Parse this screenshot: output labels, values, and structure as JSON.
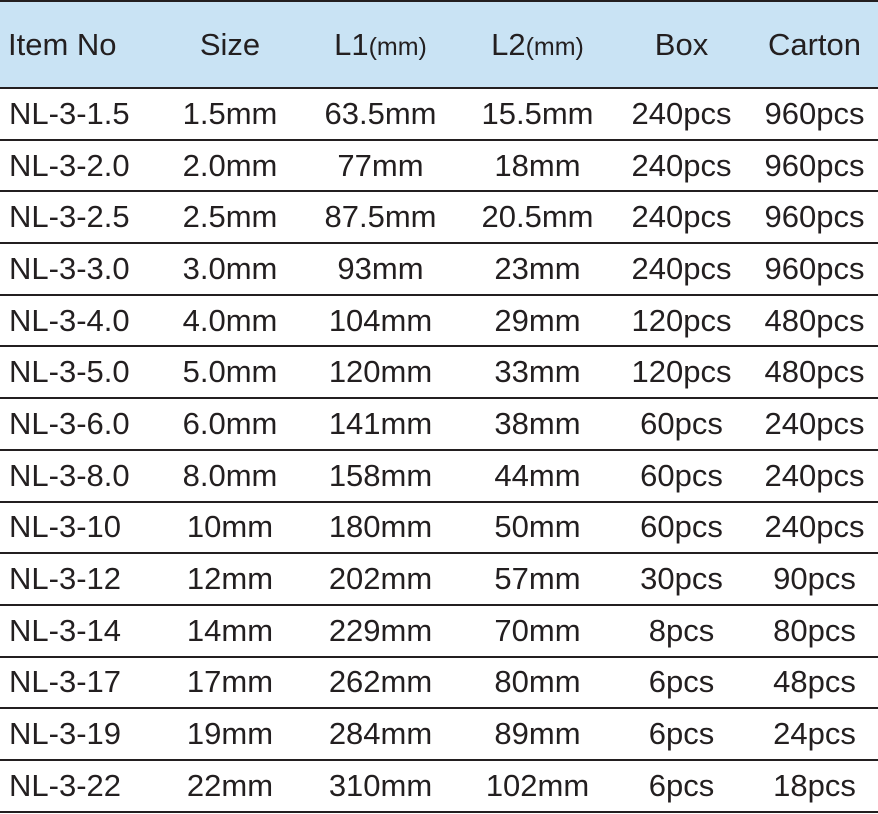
{
  "table": {
    "headers": [
      {
        "label": "Item No",
        "unit": ""
      },
      {
        "label": "Size",
        "unit": ""
      },
      {
        "label": "L1",
        "unit": "(mm)"
      },
      {
        "label": "L2",
        "unit": "(mm)"
      },
      {
        "label": "Box",
        "unit": ""
      },
      {
        "label": "Carton",
        "unit": ""
      }
    ],
    "rows": [
      [
        "NL-3-1.5",
        "1.5mm",
        "63.5mm",
        "15.5mm",
        "240pcs",
        "960pcs"
      ],
      [
        "NL-3-2.0",
        "2.0mm",
        "77mm",
        "18mm",
        "240pcs",
        "960pcs"
      ],
      [
        "NL-3-2.5",
        "2.5mm",
        "87.5mm",
        "20.5mm",
        "240pcs",
        "960pcs"
      ],
      [
        "NL-3-3.0",
        "3.0mm",
        "93mm",
        "23mm",
        "240pcs",
        "960pcs"
      ],
      [
        "NL-3-4.0",
        "4.0mm",
        "104mm",
        "29mm",
        "120pcs",
        "480pcs"
      ],
      [
        "NL-3-5.0",
        "5.0mm",
        "120mm",
        "33mm",
        "120pcs",
        "480pcs"
      ],
      [
        "NL-3-6.0",
        "6.0mm",
        "141mm",
        "38mm",
        "60pcs",
        "240pcs"
      ],
      [
        "NL-3-8.0",
        "8.0mm",
        "158mm",
        "44mm",
        "60pcs",
        "240pcs"
      ],
      [
        "NL-3-10",
        "10mm",
        "180mm",
        "50mm",
        "60pcs",
        "240pcs"
      ],
      [
        "NL-3-12",
        "12mm",
        "202mm",
        "57mm",
        "30pcs",
        "90pcs"
      ],
      [
        "NL-3-14",
        "14mm",
        "229mm",
        "70mm",
        "8pcs",
        "80pcs"
      ],
      [
        "NL-3-17",
        "17mm",
        "262mm",
        "80mm",
        "6pcs",
        "48pcs"
      ],
      [
        "NL-3-19",
        "19mm",
        "284mm",
        "89mm",
        "6pcs",
        "24pcs"
      ],
      [
        "NL-3-22",
        "22mm",
        "310mm",
        "102mm",
        "6pcs",
        "18pcs"
      ]
    ]
  },
  "colors": {
    "header_background": "#c9e3f4",
    "text": "#231f20",
    "rule": "#231f20"
  }
}
